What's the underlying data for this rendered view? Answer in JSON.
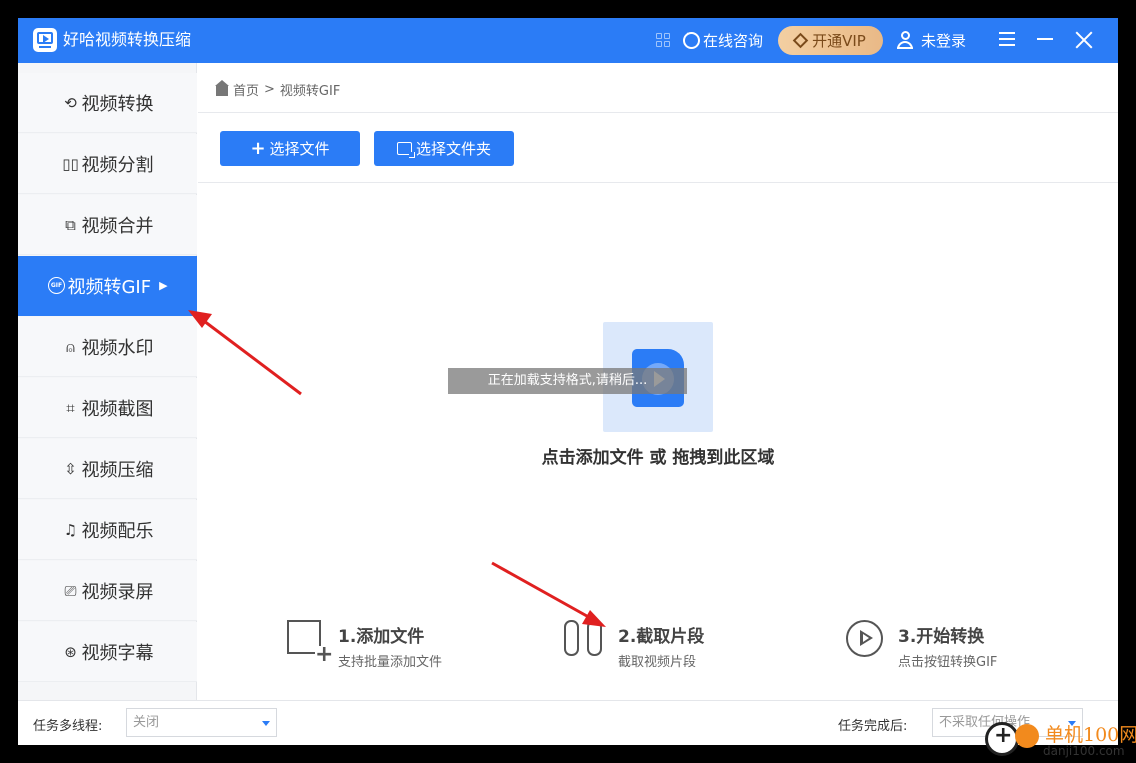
{
  "app": {
    "title": "好哈视频转换压缩",
    "consult_label": "在线咨询",
    "vip_label": "开通VIP",
    "login_label": "未登录"
  },
  "sidebar": {
    "items": [
      {
        "label": "视频转换",
        "icon": "convert-icon"
      },
      {
        "label": "视频分割",
        "icon": "split-icon"
      },
      {
        "label": "视频合并",
        "icon": "merge-icon"
      },
      {
        "label": "视频转GIF",
        "icon": "gif-icon",
        "active": true
      },
      {
        "label": "视频水印",
        "icon": "watermark-icon"
      },
      {
        "label": "视频截图",
        "icon": "crop-icon"
      },
      {
        "label": "视频压缩",
        "icon": "compress-icon"
      },
      {
        "label": "视频配乐",
        "icon": "music-icon"
      },
      {
        "label": "视频录屏",
        "icon": "record-icon"
      },
      {
        "label": "视频字幕",
        "icon": "subtitle-icon"
      }
    ]
  },
  "breadcrumb": {
    "home": "首页",
    "current": "视频转GIF"
  },
  "toolbar": {
    "select_file": "选择文件",
    "select_folder": "选择文件夹"
  },
  "dropzone": {
    "loading_text": "正在加载支持格式,请稍后...",
    "hint": "点击添加文件 或 拖拽到此区域"
  },
  "steps": [
    {
      "title": "1.添加文件",
      "sub": "支持批量添加文件"
    },
    {
      "title": "2.截取片段",
      "sub": "截取视频片段"
    },
    {
      "title": "3.开始转换",
      "sub": "点击按钮转换GIF"
    }
  ],
  "statusbar": {
    "threads_label": "任务多线程:",
    "threads_value": "关闭",
    "after_label": "任务完成后:",
    "after_value": "不采取任何操作"
  },
  "watermark": {
    "name": "单机100网",
    "url": "danji100.com"
  },
  "colors": {
    "accent": "#2b7cf6",
    "vip": "#e9b987",
    "annotation_arrow": "#e02020"
  }
}
